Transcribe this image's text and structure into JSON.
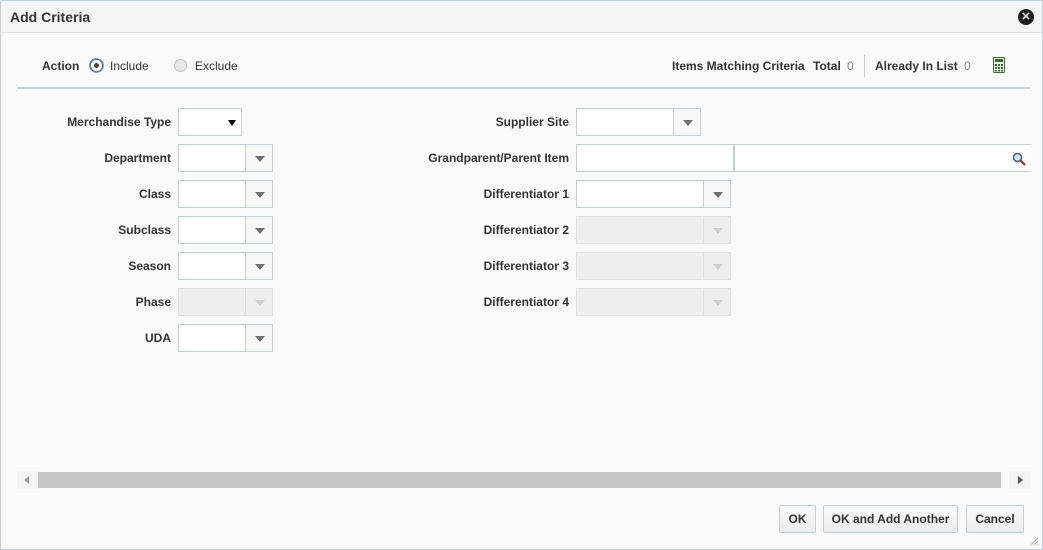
{
  "dialog": {
    "title": "Add Criteria"
  },
  "action": {
    "label": "Action",
    "options": [
      {
        "label": "Include",
        "selected": true
      },
      {
        "label": "Exclude",
        "selected": false
      }
    ]
  },
  "matching": {
    "label": "Items Matching Criteria",
    "total_label": "Total",
    "total_value": "0",
    "already_label": "Already In List",
    "already_value": "0"
  },
  "left_fields": {
    "merchandise_type": {
      "label": "Merchandise Type",
      "value": ""
    },
    "department": {
      "label": "Department",
      "value": ""
    },
    "class": {
      "label": "Class",
      "value": ""
    },
    "subclass": {
      "label": "Subclass",
      "value": ""
    },
    "season": {
      "label": "Season",
      "value": ""
    },
    "phase": {
      "label": "Phase",
      "value": "",
      "disabled": true
    },
    "uda": {
      "label": "UDA",
      "value": ""
    }
  },
  "right_fields": {
    "supplier_site": {
      "label": "Supplier Site",
      "value": ""
    },
    "grandparent_parent_item": {
      "label": "Grandparent/Parent Item",
      "value": "",
      "description": ""
    },
    "differentiator_1": {
      "label": "Differentiator 1",
      "value": ""
    },
    "differentiator_2": {
      "label": "Differentiator 2",
      "value": "",
      "disabled": true
    },
    "differentiator_3": {
      "label": "Differentiator 3",
      "value": "",
      "disabled": true
    },
    "differentiator_4": {
      "label": "Differentiator 4",
      "value": "",
      "disabled": true
    }
  },
  "buttons": {
    "ok": "OK",
    "ok_add_another": "OK and Add Another",
    "cancel": "Cancel"
  },
  "icons": {
    "close": "close-icon",
    "calculator": "calculator-icon",
    "search": "search-icon"
  },
  "colors": {
    "border": "#c4ced7",
    "rule": "#c4d3e0",
    "background": "#fafafa"
  }
}
